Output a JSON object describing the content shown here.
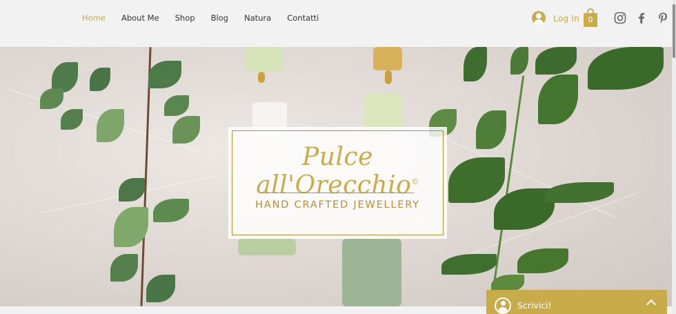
{
  "nav": {
    "items": [
      {
        "label": "Home",
        "active": true
      },
      {
        "label": "About Me",
        "active": false
      },
      {
        "label": "Shop",
        "active": false
      },
      {
        "label": "Blog",
        "active": false
      },
      {
        "label": "Natura",
        "active": false
      },
      {
        "label": "Contatti",
        "active": false
      }
    ]
  },
  "account": {
    "login_label": "Log In"
  },
  "cart": {
    "count": "0"
  },
  "social": [
    "instagram-icon",
    "facebook-icon",
    "pinterest-icon"
  ],
  "hero": {
    "brand": "Pulce all'Orecchio",
    "trademark": "©",
    "tagline": "HAND CRAFTED JEWELLERY"
  },
  "chat": {
    "label": "Scrivici!"
  },
  "colors": {
    "accent": "#c8ac4a",
    "frame": "#b98c35",
    "header_bg": "#f2f2f2"
  }
}
